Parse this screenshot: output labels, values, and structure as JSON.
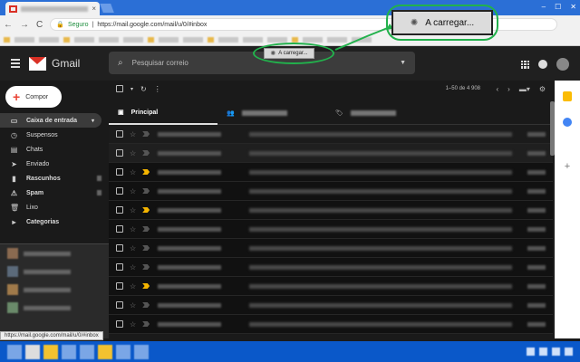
{
  "browser": {
    "tab_close": "×",
    "window_buttons": [
      "–",
      "☐",
      "✕"
    ],
    "nav_back": "←",
    "nav_forward": "→",
    "nav_reload": "C",
    "secure_label": "Seguro",
    "url": "https://mail.google.com/mail/u/0/#inbox"
  },
  "gmail": {
    "app_name": "Gmail",
    "search_placeholder": "Pesquisar correio",
    "compose_label": "Compor",
    "nav": [
      {
        "label": "Caixa de entrada",
        "icon": "inbox-icon",
        "glyph": "▭",
        "active": true
      },
      {
        "label": "Suspensos",
        "icon": "clock-icon",
        "glyph": "◷"
      },
      {
        "label": "Chats",
        "icon": "chat-icon",
        "glyph": "▤"
      },
      {
        "label": "Enviado",
        "icon": "send-icon",
        "glyph": "➤"
      },
      {
        "label": "Rascunhos",
        "icon": "draft-icon",
        "glyph": "▮"
      },
      {
        "label": "Spam",
        "icon": "spam-icon",
        "glyph": "⚠"
      },
      {
        "label": "Lixo",
        "icon": "trash-icon",
        "glyph": "🗑"
      },
      {
        "label": "Categorias",
        "icon": "label-icon",
        "glyph": "▸"
      }
    ],
    "page_info": "1–50 de 4 908",
    "category_tabs": [
      {
        "label": "Principal",
        "icon": "inbox-tab-icon",
        "active": true
      },
      {
        "label": "",
        "icon": "people-icon"
      },
      {
        "label": "",
        "icon": "tag-icon"
      }
    ]
  },
  "overlays": {
    "loading_small": "A carregar...",
    "loading_big": "A carregar..."
  },
  "status_url": "https://mail.google.com/mail/u/0/#inbox",
  "colors": {
    "accent_green": "#22b14c",
    "gmail_red": "#d93025",
    "important_yellow": "#f4b400"
  }
}
